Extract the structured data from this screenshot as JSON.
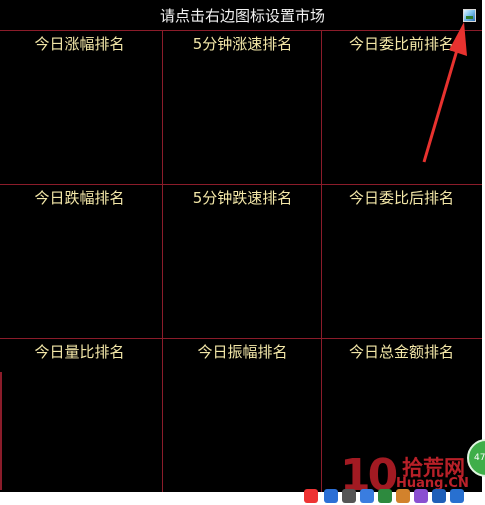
{
  "header": {
    "title": "请点击右边图标设置市场"
  },
  "panels": [
    {
      "title": "今日涨幅排名"
    },
    {
      "title": "5分钟涨速排名"
    },
    {
      "title": "今日委比前排名"
    },
    {
      "title": "今日跌幅排名"
    },
    {
      "title": "5分钟跌速排名"
    },
    {
      "title": "今日委比后排名"
    },
    {
      "title": "今日量比排名"
    },
    {
      "title": "今日振幅排名"
    },
    {
      "title": "今日总金额排名"
    }
  ],
  "watermark": {
    "number": "10",
    "chinese": "拾荒网",
    "url": "Huang.CN"
  },
  "badge": {
    "text": "47"
  },
  "colors": {
    "grid": "#8b1c2a",
    "title_text": "#f3e7a8",
    "header_text": "#f2f2f2",
    "background": "#000000",
    "arrow": "#e8322f"
  }
}
